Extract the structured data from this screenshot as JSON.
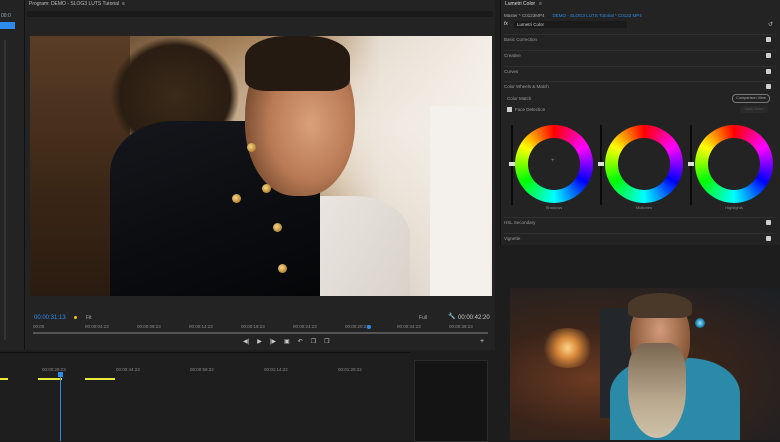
{
  "left_panel": {
    "timecode": "00:0"
  },
  "program": {
    "tab_label": "Program: DEMO - SLOG3 LUTS Tutorial",
    "menu_icon": "menu-icon",
    "current_time": "00:00:31:13",
    "fit_label": "Fit",
    "resolution": "Full",
    "duration": "00:00:42:20",
    "ruler_ticks": [
      "00:00",
      "00:00:04:23",
      "00:00:09:23",
      "00:00:14:23",
      "00:00:19:23",
      "00:00:24:23",
      "00:00:29:23",
      "00:00:34:23",
      "00:00:39:23"
    ],
    "transport": [
      "◀|",
      "▶",
      "|▶",
      "▣",
      "↶",
      "❐",
      "❐"
    ],
    "add_label": "+"
  },
  "timeline": {
    "ruler_ticks": [
      "00:00:29:23",
      "00:00:44:23",
      "00:00:59:22",
      "00:01:14:22",
      "00:01:29:22"
    ]
  },
  "lumetri": {
    "tab_label": "Lumetri Color",
    "source_label": "Master * C0123MP4",
    "sequence_label": "DEMO - SLOG3 LUTS Tutorial * C0123 MP4",
    "fx_label": "fx",
    "effect_name": "Lumetri Color",
    "sections": [
      {
        "label": "Basic Correction",
        "checked": true
      },
      {
        "label": "Creative",
        "checked": true
      },
      {
        "label": "Curves",
        "checked": true
      },
      {
        "label": "Color Wheels & Match",
        "checked": true
      }
    ],
    "color_match_label": "Color Match",
    "comparison_label": "Comparison View",
    "face_detection_label": "Face Detection",
    "apply_match_label": "Apply Match",
    "wheels": [
      "Shadows",
      "Midtones",
      "Highlights"
    ],
    "bottom_sections": [
      {
        "label": "HSL Secondary",
        "checked": true
      },
      {
        "label": "Vignette",
        "checked": true
      }
    ]
  },
  "colors": {
    "accent": "#2d8ceb",
    "marker": "#f2c21a",
    "clip": "#e8e63a"
  }
}
